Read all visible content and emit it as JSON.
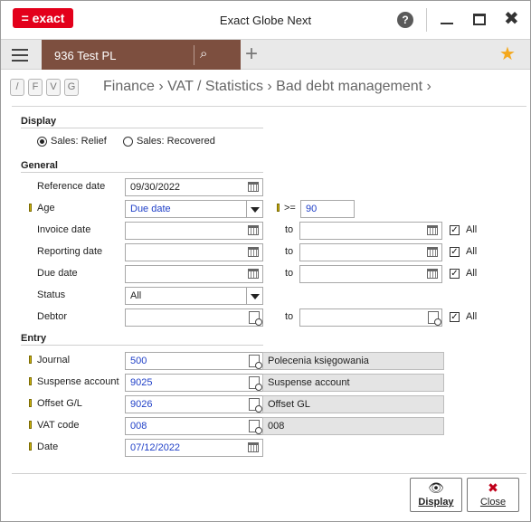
{
  "app": {
    "logo_text": "= exact",
    "title": "Exact Globe Next",
    "help": "?",
    "minimize": "—",
    "maximize": "☐",
    "close": "✖"
  },
  "nav": {
    "company": "936  Test PL",
    "search_icon": "⌕",
    "add": "+",
    "favorite": "★"
  },
  "quick_buttons": [
    "/",
    "F",
    "V",
    "G"
  ],
  "breadcrumb": "Finance › VAT / Statistics › Bad debt management ›",
  "display": {
    "section": "Display",
    "options": [
      {
        "label": "Sales: Relief",
        "selected": true
      },
      {
        "label": "Sales: Recovered",
        "selected": false
      }
    ]
  },
  "general": {
    "section": "General",
    "reference_date": {
      "label": "Reference date",
      "value": "09/30/2022"
    },
    "age": {
      "label": "Age",
      "value": "Due date",
      "op": ">=",
      "threshold": "90"
    },
    "invoice_date": {
      "label": "Invoice date",
      "from": "",
      "to_label": "to",
      "to": "",
      "all_label": "All",
      "all": true
    },
    "reporting_date": {
      "label": "Reporting date",
      "from": "",
      "to_label": "to",
      "to": "",
      "all_label": "All",
      "all": true
    },
    "due_date": {
      "label": "Due date",
      "from": "",
      "to_label": "to",
      "to": "",
      "all_label": "All",
      "all": true
    },
    "status": {
      "label": "Status",
      "value": "All"
    },
    "debtor": {
      "label": "Debtor",
      "from": "",
      "to_label": "to",
      "to": "",
      "all_label": "All",
      "all": true
    }
  },
  "entry": {
    "section": "Entry",
    "journal": {
      "label": "Journal",
      "value": "500",
      "desc": "Polecenia księgowania"
    },
    "suspense": {
      "label": "Suspense account",
      "value": "9025",
      "desc": "Suspense account"
    },
    "offset": {
      "label": "Offset G/L",
      "value": "9026",
      "desc": "Offset GL"
    },
    "vat": {
      "label": "VAT code",
      "value": "008",
      "desc": "008"
    },
    "date": {
      "label": "Date",
      "value": "07/12/2022"
    }
  },
  "footer": {
    "display": {
      "icon": "👁",
      "label": "Display"
    },
    "close": {
      "icon": "✖",
      "label": "Close"
    }
  },
  "colors": {
    "brand": "#e3001b",
    "company_bar": "#7d4f3f",
    "value_blue": "#2141c8",
    "star": "#f4a81d"
  }
}
